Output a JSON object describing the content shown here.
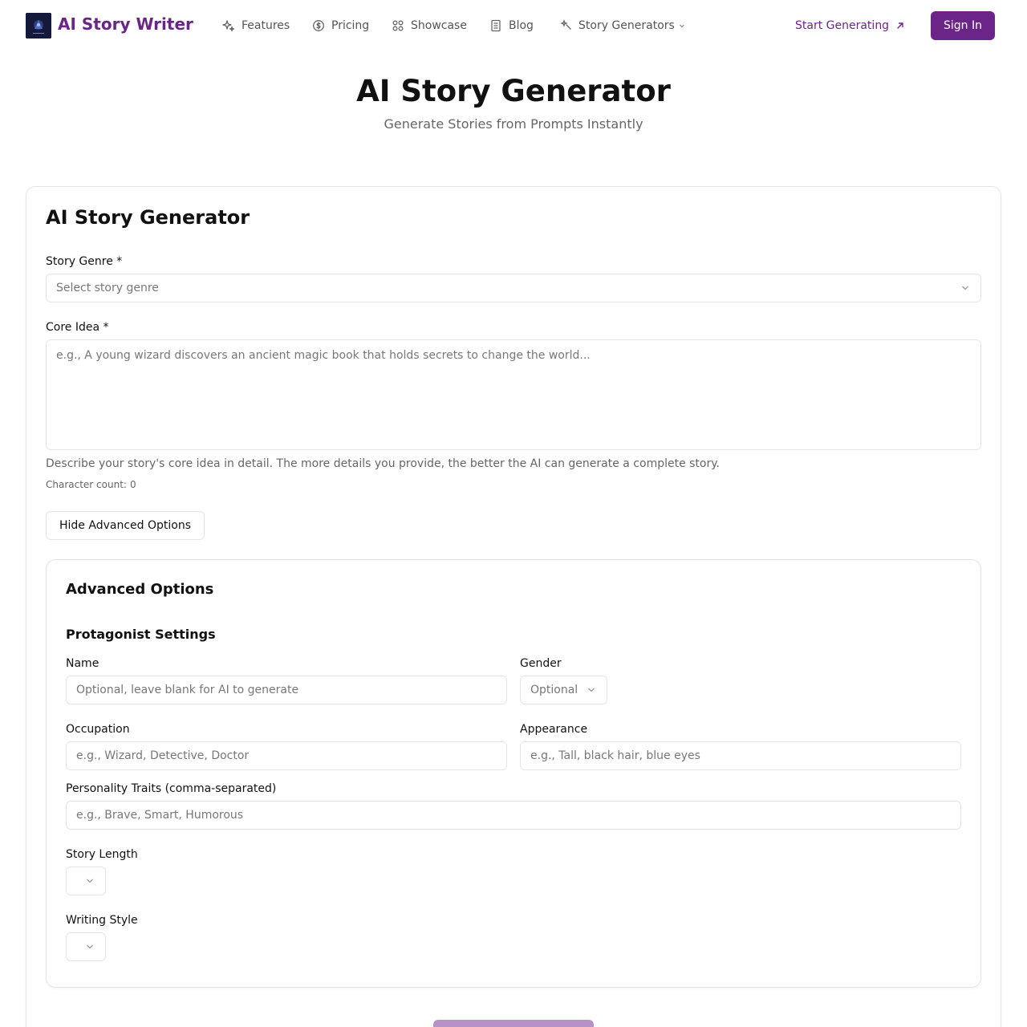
{
  "nav": {
    "brand": "AI Story Writer",
    "items": [
      {
        "label": "Features",
        "icon": "sparkles-icon"
      },
      {
        "label": "Pricing",
        "icon": "dollar-circle-icon"
      },
      {
        "label": "Showcase",
        "icon": "grid-icon"
      },
      {
        "label": "Blog",
        "icon": "document-icon"
      },
      {
        "label": "Story Generators",
        "icon": "wand-icon"
      }
    ],
    "cta": "Start Generating",
    "sign_in": "Sign In"
  },
  "hero": {
    "title": "AI Story Generator",
    "subtitle": "Generate Stories from Prompts Instantly"
  },
  "form": {
    "title": "AI Story Generator",
    "genre_label": "Story Genre *",
    "genre_placeholder": "Select story genre",
    "idea_label": "Core Idea *",
    "idea_placeholder": "e.g., A young wizard discovers an ancient magic book that holds secrets to change the world...",
    "idea_help": "Describe your story's core idea in detail. The more details you provide, the better the AI can generate a complete story.",
    "char_count_label": "Character count:",
    "char_count": "0",
    "toggle_advanced": "Hide Advanced Options"
  },
  "advanced": {
    "title": "Advanced Options",
    "protagonist_title": "Protagonist Settings",
    "name_label": "Name",
    "name_placeholder": "Optional, leave blank for AI to generate",
    "gender_label": "Gender",
    "gender_value": "Optional",
    "occupation_label": "Occupation",
    "occupation_placeholder": "e.g., Wizard, Detective, Doctor",
    "appearance_label": "Appearance",
    "appearance_placeholder": "e.g., Tall, black hair, blue eyes",
    "traits_label": "Personality Traits (comma-separated)",
    "traits_placeholder": "e.g., Brave, Smart, Humorous",
    "length_label": "Story Length",
    "length_value": "",
    "style_label": "Writing Style",
    "style_value": ""
  },
  "colors": {
    "brand": "#6b2589",
    "submit_disabled": "#b692c9",
    "border": "#e4e4e7"
  }
}
